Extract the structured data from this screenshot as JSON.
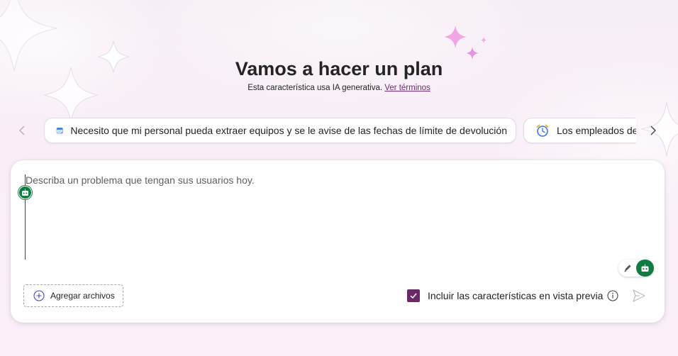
{
  "header": {
    "title": "Vamos a hacer un plan",
    "subtitle_text": "Esta característica usa IA generativa.",
    "terms_link": "Ver términos"
  },
  "suggestions": [
    {
      "icon": "calendar-icon",
      "text": "Necesito que mi personal pueda extraer equipos y se le avise de las fechas de límite de devolución"
    },
    {
      "icon": "alarm-clock-icon",
      "text": "Los empleados de"
    }
  ],
  "prompt": {
    "placeholder": "Describa un problema que tengan sus usuarios hoy.",
    "value": "",
    "add_files_label": "Agregar archivos",
    "preview_label": "Incluir las características en vista previa",
    "preview_checked": true
  },
  "colors": {
    "accent": "#742774",
    "checkbox": "#6b2768",
    "copilot_green": "#107c41"
  }
}
